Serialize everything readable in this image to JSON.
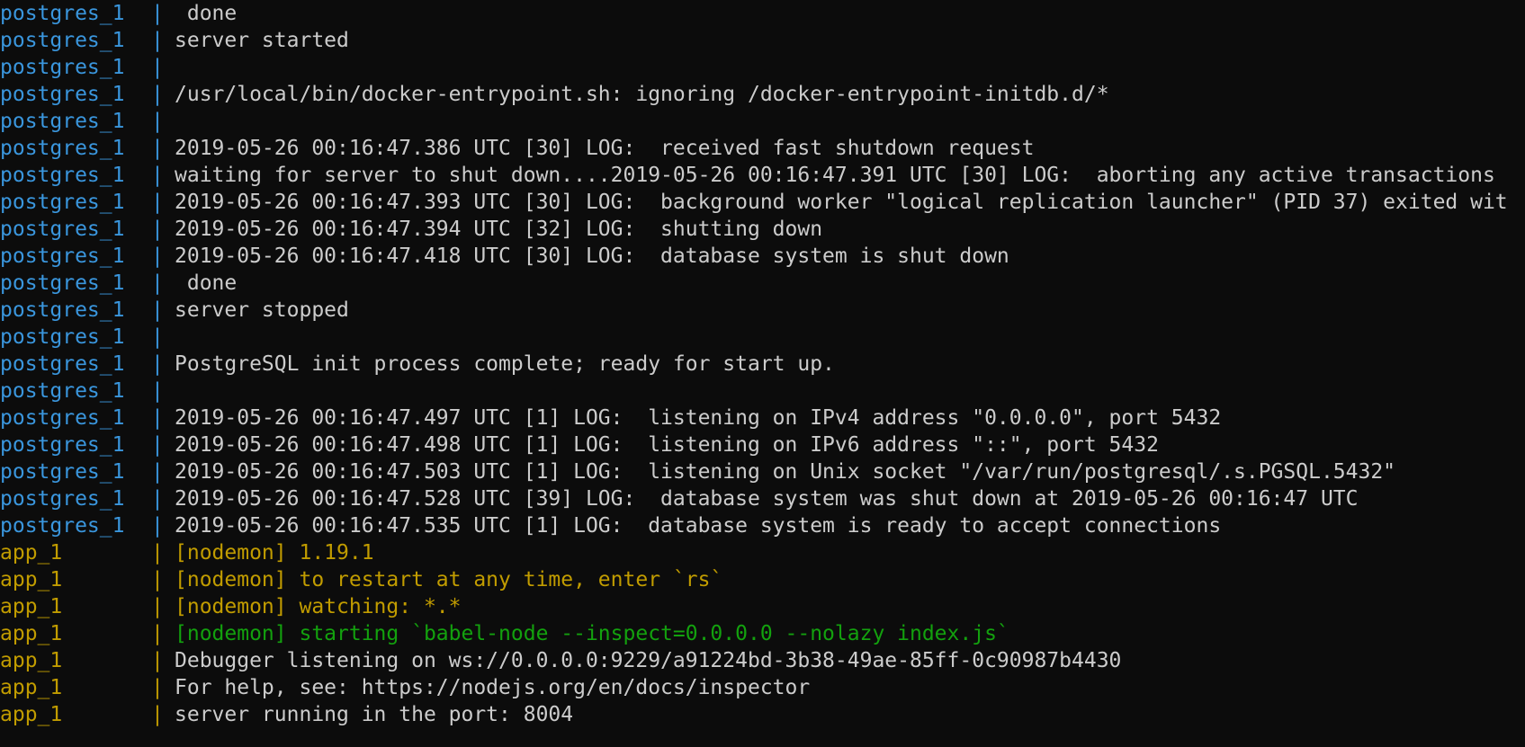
{
  "colors": {
    "background": "#0c0c0c",
    "text": "#cccccc",
    "postgres_prefix": "#3a96dd",
    "app_prefix": "#c19c00",
    "nodemon_yellow": "#c19c00",
    "nodemon_green": "#13a10e"
  },
  "separator": "|",
  "lines": [
    {
      "service": "postgres_1",
      "msg": " done"
    },
    {
      "service": "postgres_1",
      "msg": "server started"
    },
    {
      "service": "postgres_1",
      "msg": ""
    },
    {
      "service": "postgres_1",
      "msg": "/usr/local/bin/docker-entrypoint.sh: ignoring /docker-entrypoint-initdb.d/*"
    },
    {
      "service": "postgres_1",
      "msg": ""
    },
    {
      "service": "postgres_1",
      "msg": "2019-05-26 00:16:47.386 UTC [30] LOG:  received fast shutdown request"
    },
    {
      "service": "postgres_1",
      "msg": "waiting for server to shut down....2019-05-26 00:16:47.391 UTC [30] LOG:  aborting any active transactions"
    },
    {
      "service": "postgres_1",
      "msg": "2019-05-26 00:16:47.393 UTC [30] LOG:  background worker \"logical replication launcher\" (PID 37) exited wit"
    },
    {
      "service": "postgres_1",
      "msg": "2019-05-26 00:16:47.394 UTC [32] LOG:  shutting down"
    },
    {
      "service": "postgres_1",
      "msg": "2019-05-26 00:16:47.418 UTC [30] LOG:  database system is shut down"
    },
    {
      "service": "postgres_1",
      "msg": " done"
    },
    {
      "service": "postgres_1",
      "msg": "server stopped"
    },
    {
      "service": "postgres_1",
      "msg": ""
    },
    {
      "service": "postgres_1",
      "msg": "PostgreSQL init process complete; ready for start up."
    },
    {
      "service": "postgres_1",
      "msg": ""
    },
    {
      "service": "postgres_1",
      "msg": "2019-05-26 00:16:47.497 UTC [1] LOG:  listening on IPv4 address \"0.0.0.0\", port 5432"
    },
    {
      "service": "postgres_1",
      "msg": "2019-05-26 00:16:47.498 UTC [1] LOG:  listening on IPv6 address \"::\", port 5432"
    },
    {
      "service": "postgres_1",
      "msg": "2019-05-26 00:16:47.503 UTC [1] LOG:  listening on Unix socket \"/var/run/postgresql/.s.PGSQL.5432\""
    },
    {
      "service": "postgres_1",
      "msg": "2019-05-26 00:16:47.528 UTC [39] LOG:  database system was shut down at 2019-05-26 00:16:47 UTC"
    },
    {
      "service": "postgres_1",
      "msg": "2019-05-26 00:16:47.535 UTC [1] LOG:  database system is ready to accept connections"
    },
    {
      "service": "app_1",
      "msg": "[nodemon] 1.19.1",
      "tone": "yellow"
    },
    {
      "service": "app_1",
      "msg": "[nodemon] to restart at any time, enter `rs`",
      "tone": "yellow"
    },
    {
      "service": "app_1",
      "msg": "[nodemon] watching: *.*",
      "tone": "yellow"
    },
    {
      "service": "app_1",
      "msg": "[nodemon] starting `babel-node --inspect=0.0.0.0 --nolazy index.js`",
      "tone": "green"
    },
    {
      "service": "app_1",
      "msg": "Debugger listening on ws://0.0.0.0:9229/a91224bd-3b38-49ae-85ff-0c90987b4430"
    },
    {
      "service": "app_1",
      "msg": "For help, see: https://nodejs.org/en/docs/inspector"
    },
    {
      "service": "app_1",
      "msg": "server running in the port: 8004"
    }
  ]
}
